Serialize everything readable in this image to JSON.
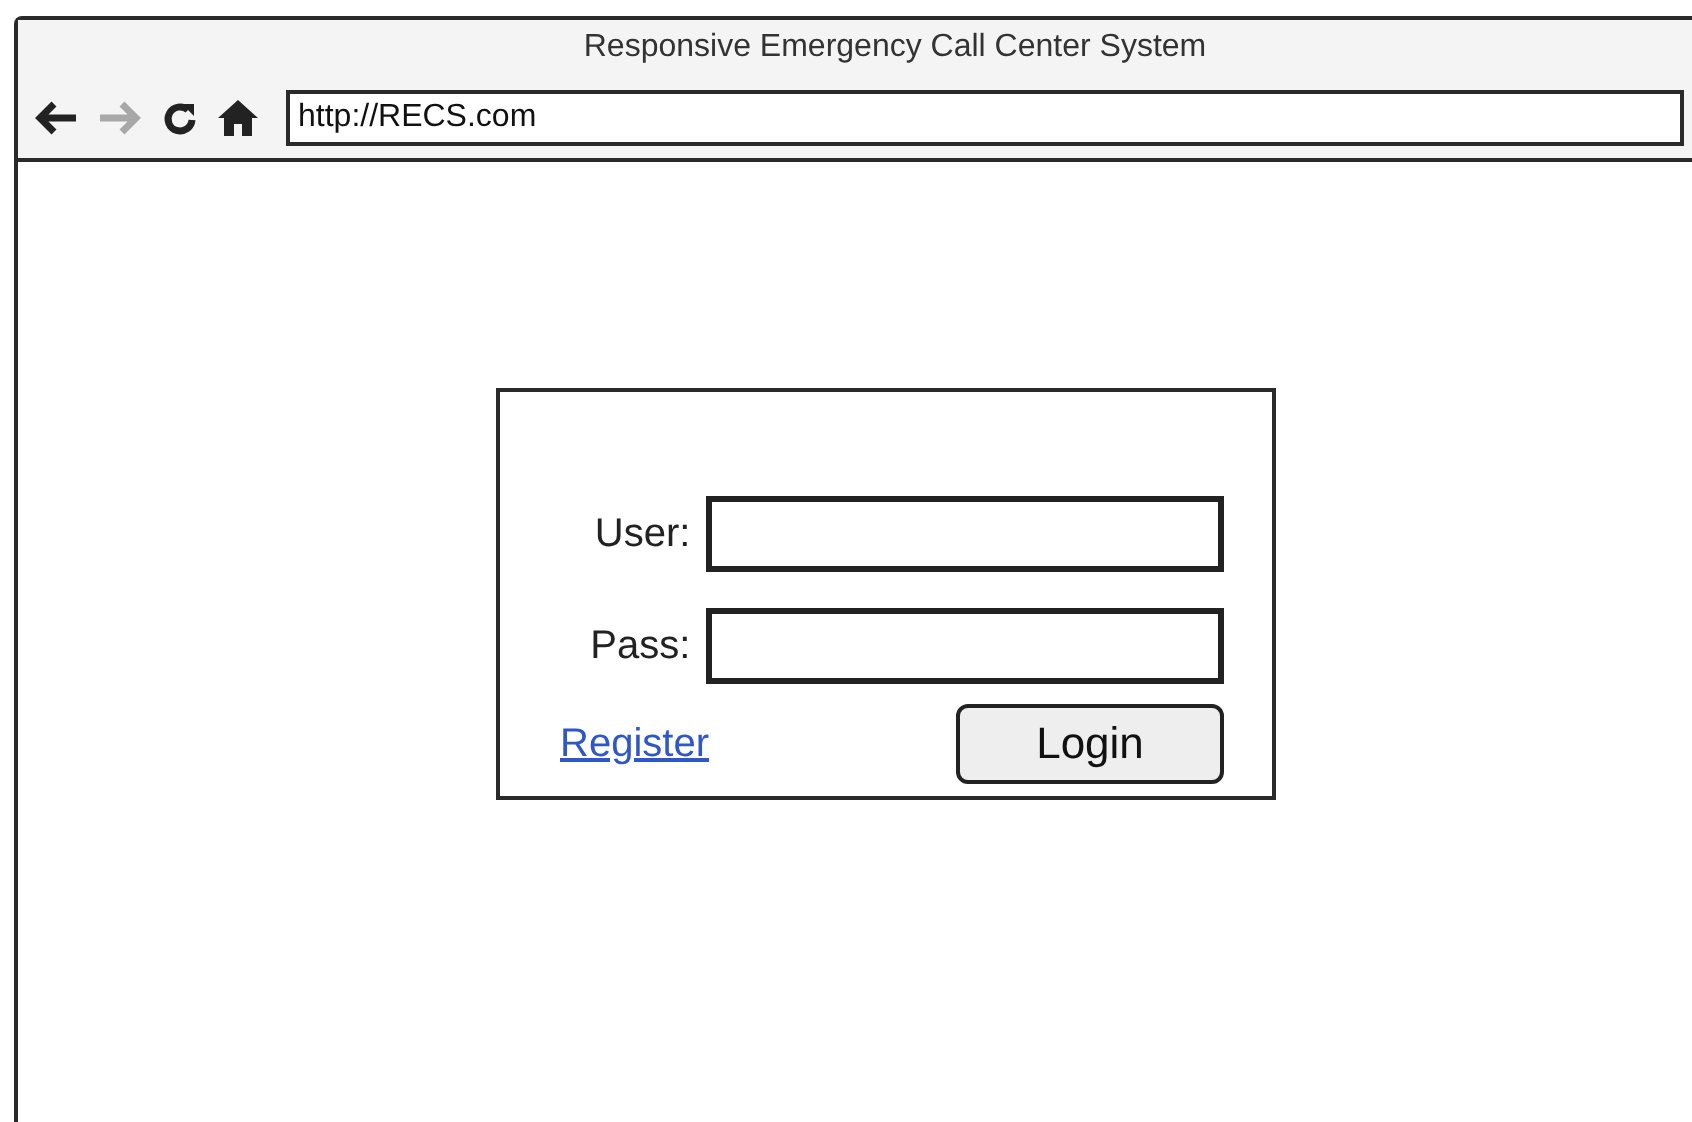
{
  "window": {
    "title": "Responsive Emergency Call Center System"
  },
  "toolbar": {
    "buttons": [
      {
        "kind": "back",
        "disabled": false
      },
      {
        "kind": "forward",
        "disabled": true
      },
      {
        "kind": "reload",
        "disabled": false
      },
      {
        "kind": "home",
        "disabled": false
      }
    ]
  },
  "address_bar": {
    "value": "http://RECS.com"
  },
  "login_form": {
    "fields": [
      {
        "label": "User:"
      },
      {
        "label": "Pass:"
      }
    ],
    "register_link": "Register",
    "login_button": "Login"
  }
}
